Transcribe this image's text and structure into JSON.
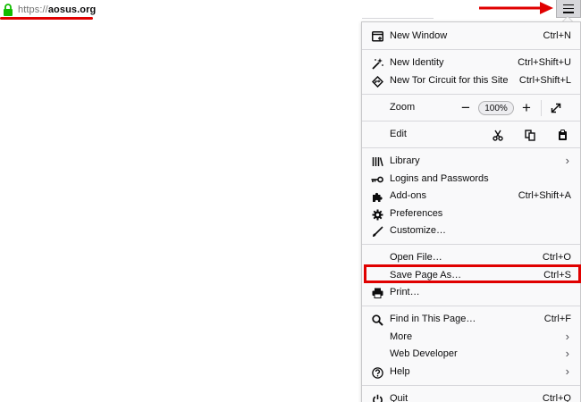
{
  "urlbar": {
    "scheme": "https://",
    "host": "aosus.org",
    "lock_icon": "lock-icon"
  },
  "menu_button_icon": "hamburger-menu-icon",
  "colors": {
    "annotation": "#e00000",
    "lock": "#12bc00",
    "panel_bg": "#f9f9fa"
  },
  "menu": {
    "new_window": {
      "label": "New Window",
      "shortcut": "Ctrl+N",
      "icon": "new-window-icon"
    },
    "new_identity": {
      "label": "New Identity",
      "shortcut": "Ctrl+Shift+U",
      "icon": "new-identity-icon"
    },
    "new_circuit": {
      "label": "New Tor Circuit for this Site",
      "shortcut": "Ctrl+Shift+L",
      "icon": "tor-circuit-icon"
    },
    "zoom": {
      "label": "Zoom",
      "minus": "−",
      "level": "100%",
      "plus": "+"
    },
    "edit": {
      "label": "Edit"
    },
    "library": {
      "label": "Library",
      "icon": "library-icon"
    },
    "logins": {
      "label": "Logins and Passwords",
      "icon": "key-icon"
    },
    "addons": {
      "label": "Add-ons",
      "shortcut": "Ctrl+Shift+A",
      "icon": "puzzle-icon"
    },
    "preferences": {
      "label": "Preferences",
      "icon": "gear-icon"
    },
    "customize": {
      "label": "Customize…",
      "icon": "paintbrush-icon"
    },
    "open_file": {
      "label": "Open File…",
      "shortcut": "Ctrl+O"
    },
    "save_page": {
      "label": "Save Page As…",
      "shortcut": "Ctrl+S"
    },
    "print": {
      "label": "Print…",
      "icon": "printer-icon"
    },
    "find": {
      "label": "Find in This Page…",
      "shortcut": "Ctrl+F",
      "icon": "search-icon"
    },
    "more": {
      "label": "More"
    },
    "web_dev": {
      "label": "Web Developer"
    },
    "help": {
      "label": "Help",
      "icon": "help-icon"
    },
    "quit": {
      "label": "Quit",
      "shortcut": "Ctrl+Q",
      "icon": "power-icon"
    }
  }
}
